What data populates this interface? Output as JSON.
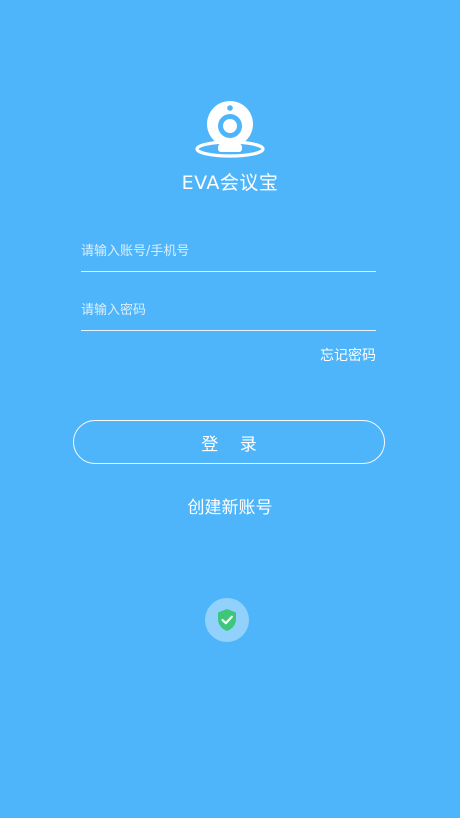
{
  "app": {
    "name": "EVA会议宝"
  },
  "login_form": {
    "account_placeholder": "请输入账号/手机号",
    "password_placeholder": "请输入密码",
    "forgot_password_label": "忘记密码",
    "login_label": "登 录",
    "register_label": "创建新账号"
  },
  "colors": {
    "background": "#4fb5fa",
    "shield": "#3cc77a"
  },
  "icons": {
    "logo": "webcam-logo-icon",
    "security": "shield-check-icon"
  }
}
